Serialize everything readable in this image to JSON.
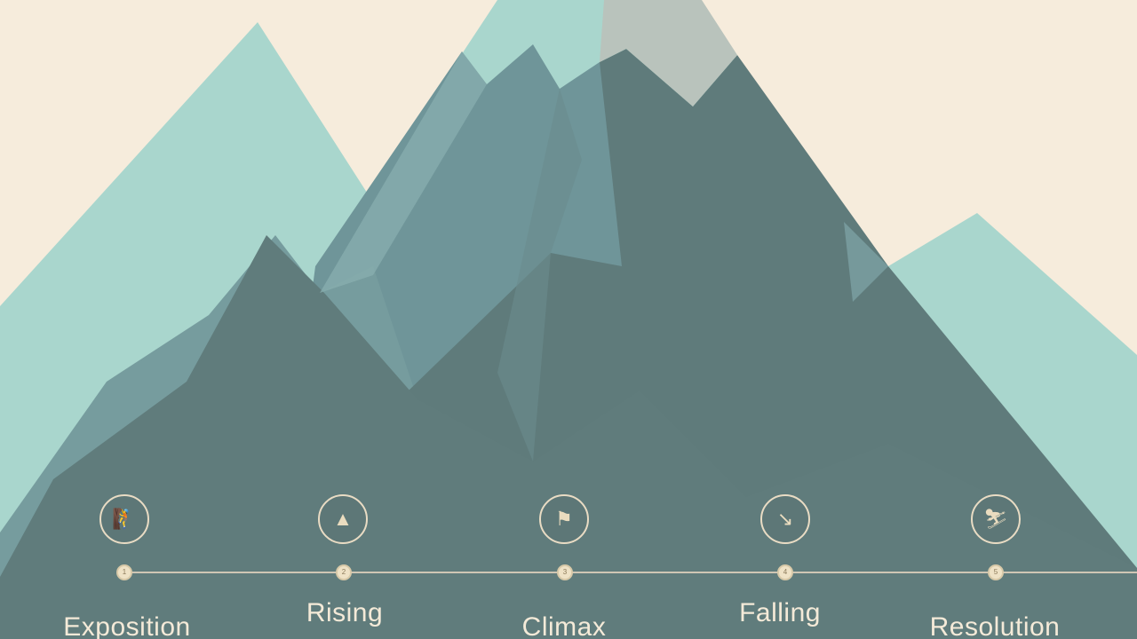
{
  "colors": {
    "sky": "#f6ecdc",
    "mountain_light": "#a9d6cd",
    "mountain_mid": "#6f9599",
    "mountain_dark": "#5f7b7b",
    "snow": "#b9c3bc",
    "accent": "#eadcbf"
  },
  "stages": [
    {
      "label": "Exposition",
      "icon": "climber-icon",
      "marker": "1"
    },
    {
      "label": "Rising",
      "icon": "ascent-icon",
      "marker": "2"
    },
    {
      "label": "Climax",
      "icon": "summit-icon",
      "marker": "3"
    },
    {
      "label": "Falling",
      "icon": "sled-descent-icon",
      "marker": "4"
    },
    {
      "label": "Resolution",
      "icon": "ski-icon",
      "marker": "5"
    }
  ]
}
